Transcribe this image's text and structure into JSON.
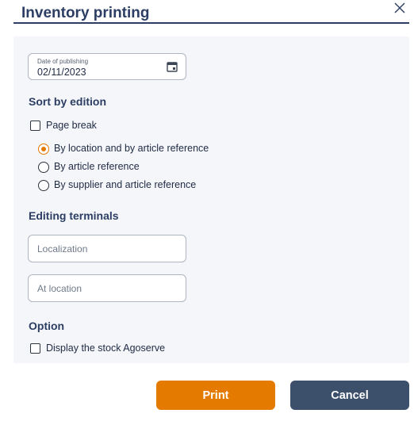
{
  "dialog": {
    "title": "Inventory printing"
  },
  "date": {
    "label": "Date of publishing",
    "value": "02/11/2023"
  },
  "sort": {
    "heading": "Sort by edition",
    "page_break": "Page break",
    "options": [
      "By location and by article reference",
      "By article reference",
      "By supplier and article reference"
    ],
    "selected_index": 0
  },
  "terminals": {
    "heading": "Editing terminals",
    "localization_placeholder": "Localization",
    "at_location_placeholder": "At location"
  },
  "option": {
    "heading": "Option",
    "display_stock": "Display the stock Agoserve"
  },
  "buttons": {
    "print": "Print",
    "cancel": "Cancel"
  },
  "colors": {
    "accent": "#e57a00",
    "primary": "#2c3e63",
    "cancel": "#3c4f6b"
  },
  "icons": [
    "close-icon",
    "calendar-icon"
  ]
}
